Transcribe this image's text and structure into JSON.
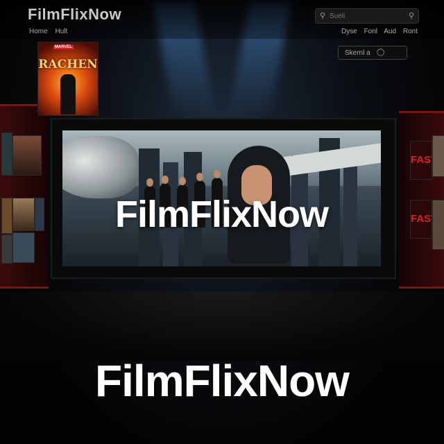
{
  "header": {
    "logo": "FilmFlixNow",
    "nav_left": [
      "Home",
      "Hult"
    ],
    "search_placeholder": "Sueli",
    "nav_right": [
      "Dyse",
      "Fonl",
      "Aud",
      "Ront"
    ],
    "signin_label": "Skernl a"
  },
  "featured_poster": {
    "studio": "MARVEL",
    "title": "RACHEN"
  },
  "hero": {
    "overlay_title": "FilmFlixNow"
  },
  "side_posters_right": [
    "FAST",
    "FAST"
  ],
  "footer": {
    "big_title": "FilmFlixNow"
  },
  "colors": {
    "wall_red": "#7a1515",
    "accent_red": "#d8202a",
    "text_white": "#ffffff"
  }
}
